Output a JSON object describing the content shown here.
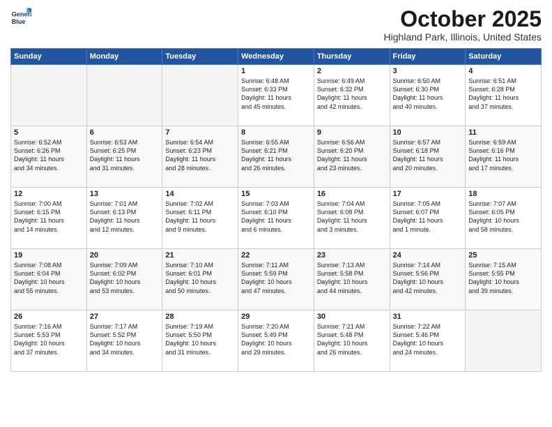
{
  "header": {
    "logo_line1": "General",
    "logo_line2": "Blue",
    "month": "October 2025",
    "location": "Highland Park, Illinois, United States"
  },
  "weekdays": [
    "Sunday",
    "Monday",
    "Tuesday",
    "Wednesday",
    "Thursday",
    "Friday",
    "Saturday"
  ],
  "weeks": [
    [
      {
        "day": "",
        "text": ""
      },
      {
        "day": "",
        "text": ""
      },
      {
        "day": "",
        "text": ""
      },
      {
        "day": "1",
        "text": "Sunrise: 6:48 AM\nSunset: 6:33 PM\nDaylight: 11 hours\nand 45 minutes."
      },
      {
        "day": "2",
        "text": "Sunrise: 6:49 AM\nSunset: 6:32 PM\nDaylight: 11 hours\nand 42 minutes."
      },
      {
        "day": "3",
        "text": "Sunrise: 6:50 AM\nSunset: 6:30 PM\nDaylight: 11 hours\nand 40 minutes."
      },
      {
        "day": "4",
        "text": "Sunrise: 6:51 AM\nSunset: 6:28 PM\nDaylight: 11 hours\nand 37 minutes."
      }
    ],
    [
      {
        "day": "5",
        "text": "Sunrise: 6:52 AM\nSunset: 6:26 PM\nDaylight: 11 hours\nand 34 minutes."
      },
      {
        "day": "6",
        "text": "Sunrise: 6:53 AM\nSunset: 6:25 PM\nDaylight: 11 hours\nand 31 minutes."
      },
      {
        "day": "7",
        "text": "Sunrise: 6:54 AM\nSunset: 6:23 PM\nDaylight: 11 hours\nand 28 minutes."
      },
      {
        "day": "8",
        "text": "Sunrise: 6:55 AM\nSunset: 6:21 PM\nDaylight: 11 hours\nand 26 minutes."
      },
      {
        "day": "9",
        "text": "Sunrise: 6:56 AM\nSunset: 6:20 PM\nDaylight: 11 hours\nand 23 minutes."
      },
      {
        "day": "10",
        "text": "Sunrise: 6:57 AM\nSunset: 6:18 PM\nDaylight: 11 hours\nand 20 minutes."
      },
      {
        "day": "11",
        "text": "Sunrise: 6:59 AM\nSunset: 6:16 PM\nDaylight: 11 hours\nand 17 minutes."
      }
    ],
    [
      {
        "day": "12",
        "text": "Sunrise: 7:00 AM\nSunset: 6:15 PM\nDaylight: 11 hours\nand 14 minutes."
      },
      {
        "day": "13",
        "text": "Sunrise: 7:01 AM\nSunset: 6:13 PM\nDaylight: 11 hours\nand 12 minutes."
      },
      {
        "day": "14",
        "text": "Sunrise: 7:02 AM\nSunset: 6:11 PM\nDaylight: 11 hours\nand 9 minutes."
      },
      {
        "day": "15",
        "text": "Sunrise: 7:03 AM\nSunset: 6:10 PM\nDaylight: 11 hours\nand 6 minutes."
      },
      {
        "day": "16",
        "text": "Sunrise: 7:04 AM\nSunset: 6:08 PM\nDaylight: 11 hours\nand 3 minutes."
      },
      {
        "day": "17",
        "text": "Sunrise: 7:05 AM\nSunset: 6:07 PM\nDaylight: 11 hours\nand 1 minute."
      },
      {
        "day": "18",
        "text": "Sunrise: 7:07 AM\nSunset: 6:05 PM\nDaylight: 10 hours\nand 58 minutes."
      }
    ],
    [
      {
        "day": "19",
        "text": "Sunrise: 7:08 AM\nSunset: 6:04 PM\nDaylight: 10 hours\nand 55 minutes."
      },
      {
        "day": "20",
        "text": "Sunrise: 7:09 AM\nSunset: 6:02 PM\nDaylight: 10 hours\nand 53 minutes."
      },
      {
        "day": "21",
        "text": "Sunrise: 7:10 AM\nSunset: 6:01 PM\nDaylight: 10 hours\nand 50 minutes."
      },
      {
        "day": "22",
        "text": "Sunrise: 7:11 AM\nSunset: 5:59 PM\nDaylight: 10 hours\nand 47 minutes."
      },
      {
        "day": "23",
        "text": "Sunrise: 7:13 AM\nSunset: 5:58 PM\nDaylight: 10 hours\nand 44 minutes."
      },
      {
        "day": "24",
        "text": "Sunrise: 7:14 AM\nSunset: 5:56 PM\nDaylight: 10 hours\nand 42 minutes."
      },
      {
        "day": "25",
        "text": "Sunrise: 7:15 AM\nSunset: 5:55 PM\nDaylight: 10 hours\nand 39 minutes."
      }
    ],
    [
      {
        "day": "26",
        "text": "Sunrise: 7:16 AM\nSunset: 5:53 PM\nDaylight: 10 hours\nand 37 minutes."
      },
      {
        "day": "27",
        "text": "Sunrise: 7:17 AM\nSunset: 5:52 PM\nDaylight: 10 hours\nand 34 minutes."
      },
      {
        "day": "28",
        "text": "Sunrise: 7:19 AM\nSunset: 5:50 PM\nDaylight: 10 hours\nand 31 minutes."
      },
      {
        "day": "29",
        "text": "Sunrise: 7:20 AM\nSunset: 5:49 PM\nDaylight: 10 hours\nand 29 minutes."
      },
      {
        "day": "30",
        "text": "Sunrise: 7:21 AM\nSunset: 5:48 PM\nDaylight: 10 hours\nand 26 minutes."
      },
      {
        "day": "31",
        "text": "Sunrise: 7:22 AM\nSunset: 5:46 PM\nDaylight: 10 hours\nand 24 minutes."
      },
      {
        "day": "",
        "text": ""
      }
    ]
  ]
}
